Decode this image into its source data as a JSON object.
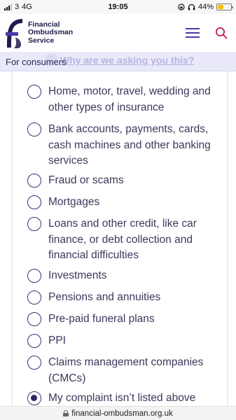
{
  "status_bar": {
    "carrier": "3",
    "network": "4G",
    "time": "19:05",
    "battery": "44%",
    "battery_level": 0.44
  },
  "header": {
    "logo_line1": "Financial",
    "logo_line2": "Ombudsman",
    "logo_line3": "Service",
    "brand_color": "#1e1e4b",
    "accent_color": "#4a3aa6",
    "search_color": "#c2185b"
  },
  "consumer_bar": {
    "label": "For consumers",
    "link": "Why are we asking you this?"
  },
  "options": [
    {
      "label": "Home, motor, travel, wedding and other types of insurance",
      "selected": false
    },
    {
      "label": "Bank accounts, payments, cards, cash machines and other banking services",
      "selected": false
    },
    {
      "label": "Fraud or scams",
      "selected": false
    },
    {
      "label": "Mortgages",
      "selected": false
    },
    {
      "label": "Loans and other credit, like car finance, or debt collection and financial difficulties",
      "selected": false
    },
    {
      "label": "Investments",
      "selected": false
    },
    {
      "label": "Pensions and annuities",
      "selected": false
    },
    {
      "label": "Pre-paid funeral plans",
      "selected": false
    },
    {
      "label": "PPI",
      "selected": false
    },
    {
      "label": "Claims management companies (CMCs)",
      "selected": false
    },
    {
      "label": "My complaint isn’t listed above",
      "selected": true
    }
  ],
  "url_bar": {
    "url": "financial-ombudsman.org.uk"
  }
}
